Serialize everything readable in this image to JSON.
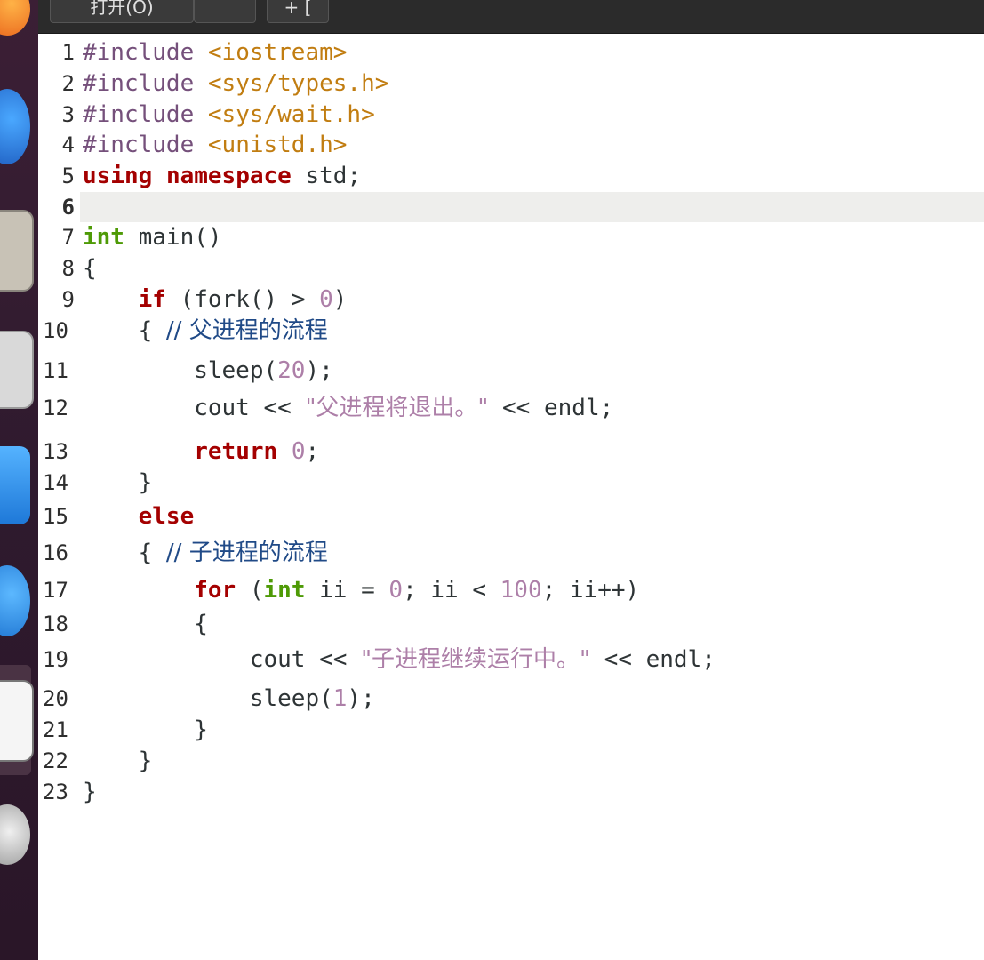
{
  "titlebar": {
    "open_label": "打开(O)",
    "extra_label": "",
    "tab_label": "+ ["
  },
  "dock": {
    "items": [
      "app-icon",
      "firefox-icon",
      "files-icon",
      "disk-icon",
      "store-icon",
      "help-icon",
      "text-editor-icon",
      "trash-icon"
    ]
  },
  "editor": {
    "current_line": 6,
    "lines": [
      {
        "n": "1",
        "segs": [
          [
            "pp",
            "#include "
          ],
          [
            "inc",
            "<iostream>"
          ]
        ]
      },
      {
        "n": "2",
        "segs": [
          [
            "pp",
            "#include "
          ],
          [
            "inc",
            "<sys/types.h>"
          ]
        ]
      },
      {
        "n": "3",
        "segs": [
          [
            "pp",
            "#include "
          ],
          [
            "inc",
            "<sys/wait.h>"
          ]
        ]
      },
      {
        "n": "4",
        "segs": [
          [
            "pp",
            "#include "
          ],
          [
            "inc",
            "<unistd.h>"
          ]
        ]
      },
      {
        "n": "5",
        "segs": [
          [
            "kw",
            "using"
          ],
          [
            "t",
            " "
          ],
          [
            "kw",
            "namespace"
          ],
          [
            "t",
            " std;"
          ]
        ]
      },
      {
        "n": "6",
        "segs": []
      },
      {
        "n": "7",
        "segs": [
          [
            "ty",
            "int"
          ],
          [
            "t",
            " main()"
          ]
        ]
      },
      {
        "n": "8",
        "segs": [
          [
            "t",
            "{"
          ]
        ]
      },
      {
        "n": "9",
        "segs": [
          [
            "t",
            "    "
          ],
          [
            "kw",
            "if"
          ],
          [
            "t",
            " (fork() > "
          ],
          [
            "num",
            "0"
          ],
          [
            "t",
            ")"
          ]
        ]
      },
      {
        "n": "10",
        "segs": [
          [
            "t",
            "    { "
          ],
          [
            "cmt",
            "// 父进程的流程"
          ]
        ]
      },
      {
        "n": "11",
        "segs": [
          [
            "t",
            "        sleep("
          ],
          [
            "num",
            "20"
          ],
          [
            "t",
            ");"
          ]
        ]
      },
      {
        "n": "12",
        "segs": [
          [
            "t",
            "        cout << "
          ],
          [
            "cjkstr",
            "\"父进程将退出。\""
          ],
          [
            "t",
            " << endl;"
          ]
        ]
      },
      {
        "n": "13",
        "segs": [
          [
            "t",
            "        "
          ],
          [
            "kw",
            "return"
          ],
          [
            "t",
            " "
          ],
          [
            "num",
            "0"
          ],
          [
            "t",
            ";"
          ]
        ]
      },
      {
        "n": "14",
        "segs": [
          [
            "t",
            "    }"
          ]
        ]
      },
      {
        "n": "15",
        "segs": [
          [
            "t",
            "    "
          ],
          [
            "kw",
            "else"
          ]
        ]
      },
      {
        "n": "16",
        "segs": [
          [
            "t",
            "    { "
          ],
          [
            "cmt",
            "// 子进程的流程"
          ]
        ]
      },
      {
        "n": "17",
        "segs": [
          [
            "t",
            "        "
          ],
          [
            "kw",
            "for"
          ],
          [
            "t",
            " ("
          ],
          [
            "ty",
            "int"
          ],
          [
            "t",
            " ii = "
          ],
          [
            "num",
            "0"
          ],
          [
            "t",
            "; ii < "
          ],
          [
            "num",
            "100"
          ],
          [
            "t",
            "; ii++)"
          ]
        ]
      },
      {
        "n": "18",
        "segs": [
          [
            "t",
            "        {"
          ]
        ]
      },
      {
        "n": "19",
        "segs": [
          [
            "t",
            "            cout << "
          ],
          [
            "cjkstr",
            "\"子进程继续运行中。\""
          ],
          [
            "t",
            " << endl;"
          ]
        ]
      },
      {
        "n": "20",
        "segs": [
          [
            "t",
            "            sleep("
          ],
          [
            "num",
            "1"
          ],
          [
            "t",
            ");"
          ]
        ]
      },
      {
        "n": "21",
        "segs": [
          [
            "t",
            "        }"
          ]
        ]
      },
      {
        "n": "22",
        "segs": [
          [
            "t",
            "    }"
          ]
        ]
      },
      {
        "n": "23",
        "segs": [
          [
            "t",
            "}"
          ]
        ]
      }
    ]
  },
  "colors": {
    "keyword": "#a40000",
    "type": "#4e9a06",
    "preproc": "#75507b",
    "include": "#c17d11",
    "number": "#ad7fa8",
    "comment": "#204a87"
  }
}
